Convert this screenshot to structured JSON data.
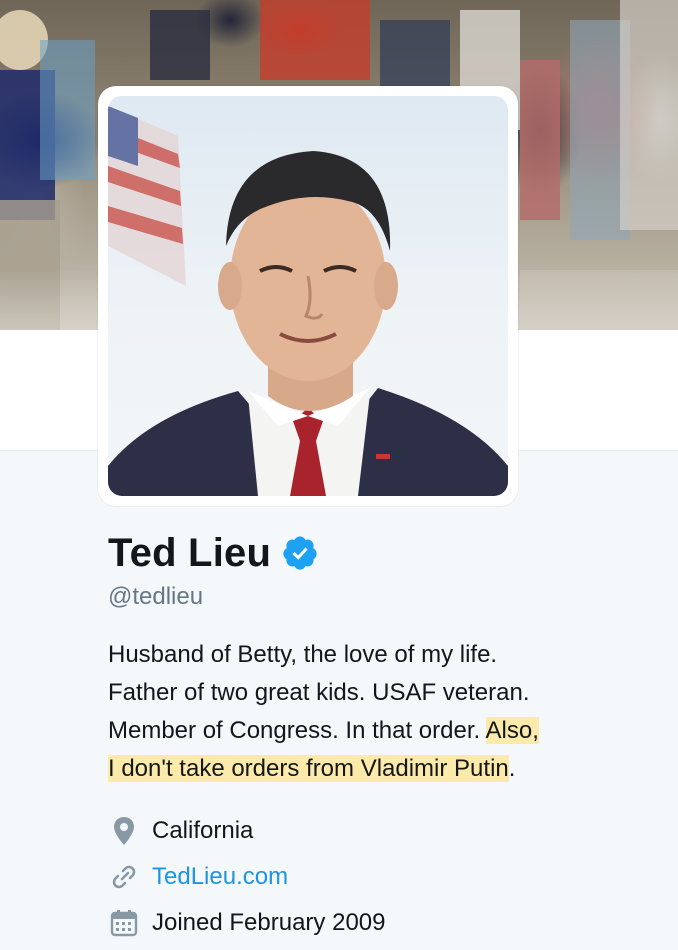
{
  "profile": {
    "name": "Ted Lieu",
    "handle": "@tedlieu",
    "verified": true,
    "bio": {
      "part1": "Husband of Betty, the love of my life.",
      "part2": "Father of two great kids. USAF veteran.",
      "part3": "Member of Congress. In that order. ",
      "highlight1": "Also,",
      "highlight2": "I don't take orders from Vladimir Putin",
      "tail": "."
    },
    "location": "California",
    "website": "TedLieu.com",
    "joined": "Joined February 2009"
  },
  "icons": {
    "verified": "verified-badge-icon",
    "location": "map-pin-icon",
    "website": "link-icon",
    "joined": "calendar-icon"
  },
  "colors": {
    "link": "#1b95e0",
    "verified": "#1da1f2",
    "highlight": "#fbeaa9",
    "secondary_text": "#657786"
  }
}
